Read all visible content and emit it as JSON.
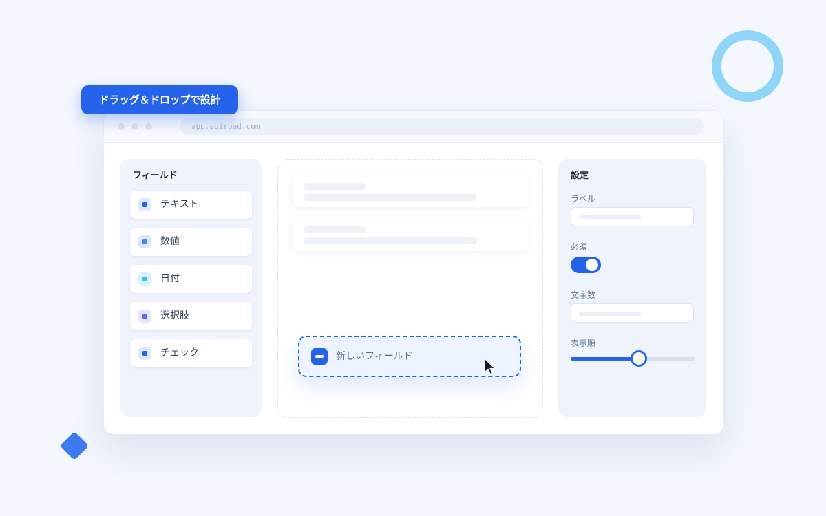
{
  "badge": {
    "text": "ドラッグ＆ドロップで設計"
  },
  "browser": {
    "url": "app.aoiroad.com"
  },
  "fields_panel": {
    "title": "フィールド",
    "items": [
      {
        "label": "テキスト",
        "icon": "text-field-icon",
        "icon_bg": "#dde9fd",
        "icon_color": "#2563eb"
      },
      {
        "label": "数値",
        "icon": "number-field-icon",
        "icon_bg": "#dde6f6",
        "icon_color": "#4a82e6"
      },
      {
        "label": "日付",
        "icon": "date-field-icon",
        "icon_bg": "#d9f1fb",
        "icon_color": "#38bdf8"
      },
      {
        "label": "選択肢",
        "icon": "choice-field-icon",
        "icon_bg": "#e6e4fa",
        "icon_color": "#6366f1"
      },
      {
        "label": "チェック",
        "icon": "check-field-icon",
        "icon_bg": "#dde9fd",
        "icon_color": "#2563eb"
      }
    ]
  },
  "canvas": {
    "dragged_field": {
      "label": "新しいフィールド",
      "icon": "minus-icon"
    }
  },
  "settings_panel": {
    "title": "設定",
    "label_field": {
      "label": "ラベル"
    },
    "required": {
      "label": "必須",
      "checked": true
    },
    "char_count": {
      "label": "文字数"
    },
    "display_order": {
      "label": "表示順",
      "value_fraction": 0.55
    }
  },
  "colors": {
    "accent": "#2563eb",
    "panel_bg": "#eef3fc",
    "page_bg": "#f4f7fd",
    "ring": "#8fd5f8",
    "diamond": "#3f7bf0"
  }
}
